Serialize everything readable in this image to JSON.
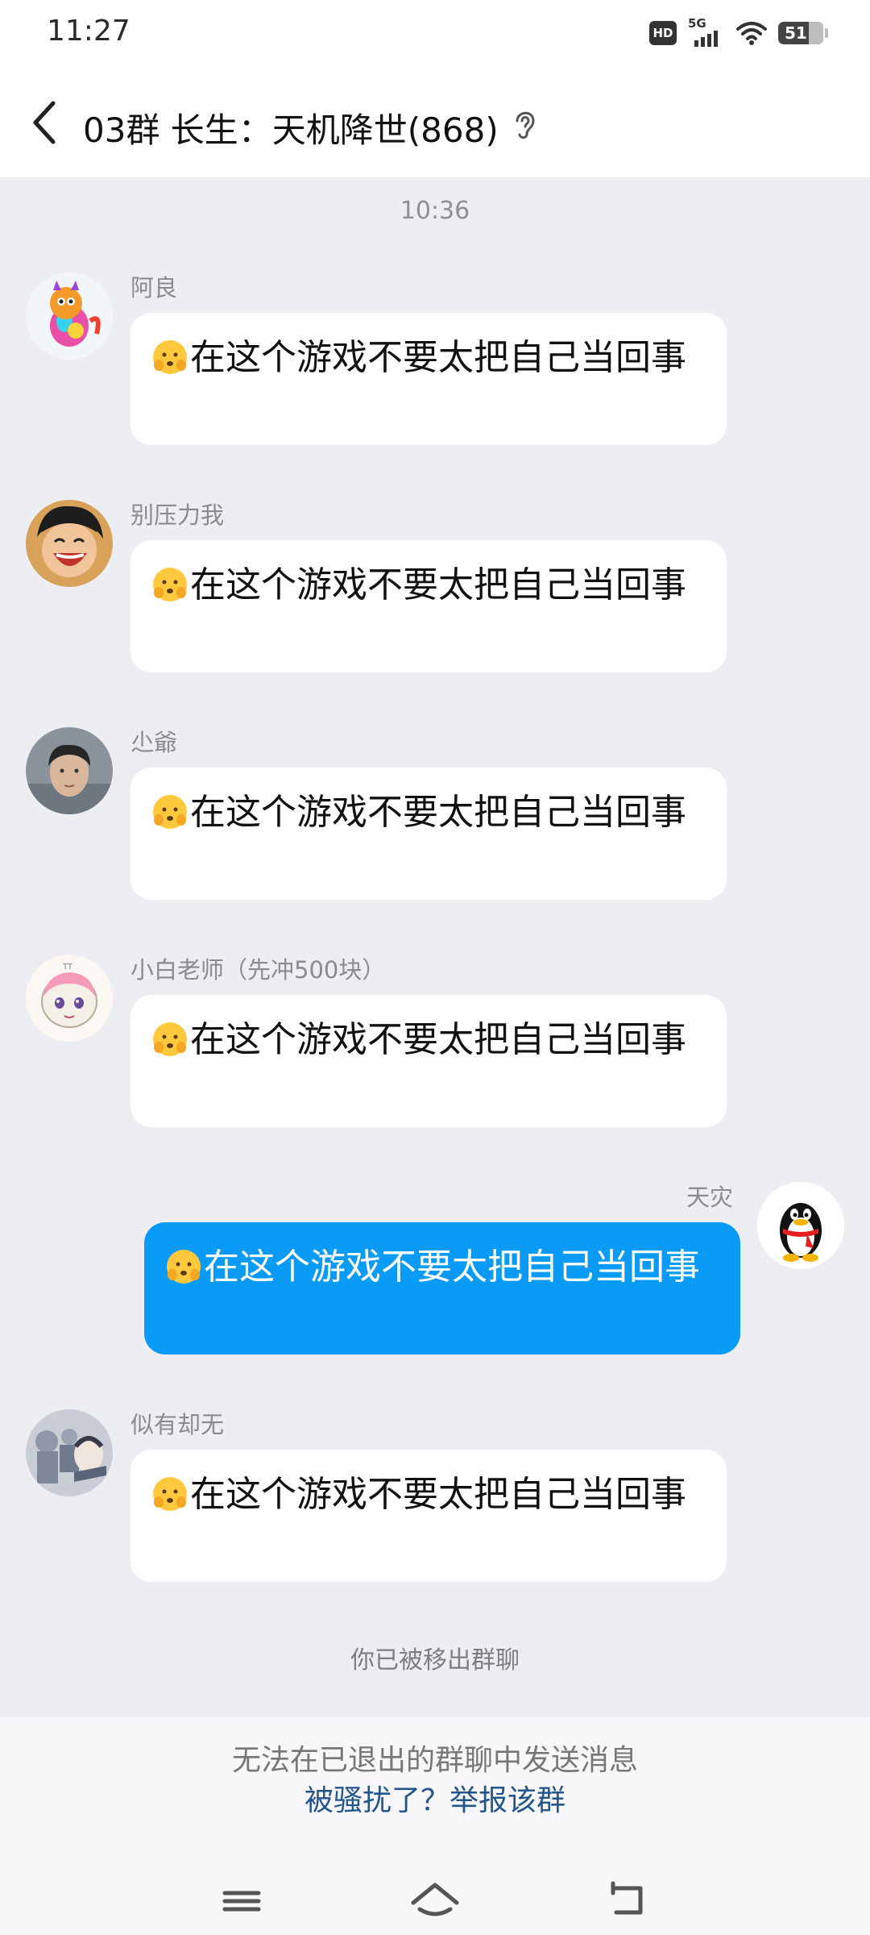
{
  "status_bar": {
    "time": "11:27",
    "hd_label": "HD",
    "network_label": "5G",
    "battery_level": "51",
    "icons": [
      "hd-icon",
      "signal-5g-icon",
      "wifi-icon",
      "battery-icon"
    ]
  },
  "header": {
    "back_icon": "chevron-left-icon",
    "title": "03群 长生：天机降世(868)",
    "ear_icon": "ear-icon"
  },
  "chat": {
    "timestamp": "10:36",
    "messages": [
      {
        "sender": "阿良",
        "emoji": "shy-face-emoji",
        "text": "在这个游戏不要太把自己当回事",
        "is_self": false
      },
      {
        "sender": "别压力我",
        "emoji": "shy-face-emoji",
        "text": "在这个游戏不要太把自己当回事",
        "is_self": false
      },
      {
        "sender": "尐爺",
        "emoji": "shy-face-emoji",
        "text": "在这个游戏不要太把自己当回事",
        "is_self": false
      },
      {
        "sender": "小白老师（先冲500块）",
        "emoji": "shy-face-emoji",
        "text": "在这个游戏不要太把自己当回事",
        "is_self": false
      },
      {
        "sender": "天灾",
        "emoji": "shy-face-emoji",
        "text": "在这个游戏不要太把自己当回事",
        "is_self": true
      },
      {
        "sender": "似有却无",
        "emoji": "shy-face-emoji",
        "text": "在这个游戏不要太把自己当回事",
        "is_self": false
      }
    ],
    "system_notice": "你已被移出群聊"
  },
  "footer": {
    "cannot_send_text": "无法在已退出的群聊中发送消息",
    "report_link": "被骚扰了？举报该群"
  },
  "nav_bar": {
    "icons": [
      "menu-icon",
      "home-icon",
      "back-icon"
    ]
  },
  "colors": {
    "chat_background": "#EDEEF2",
    "self_bubble": "#0A9BF7",
    "other_bubble": "#FFFFFF",
    "report_link": "#23558D"
  }
}
